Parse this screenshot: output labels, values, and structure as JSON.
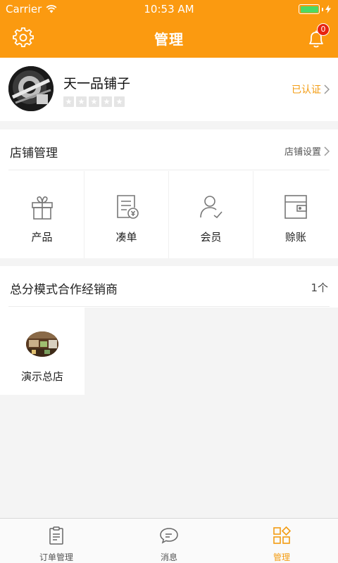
{
  "status_bar": {
    "carrier": "Carrier",
    "time": "10:53 AM"
  },
  "nav": {
    "title": "管理",
    "notification_count": "0"
  },
  "profile": {
    "shop_name": "天一品铺子",
    "verified_label": "已认证",
    "rating": 0,
    "rating_max": 5
  },
  "store_management": {
    "title": "店铺管理",
    "settings_link": "店铺设置",
    "items": [
      {
        "label": "产品",
        "icon": "gift-icon"
      },
      {
        "label": "凑单",
        "icon": "invoice-icon"
      },
      {
        "label": "会员",
        "icon": "member-icon"
      },
      {
        "label": "赊账",
        "icon": "wallet-icon"
      }
    ]
  },
  "dealers": {
    "title": "总分模式合作经销商",
    "count": "1个",
    "items": [
      {
        "name": "演示总店"
      }
    ]
  },
  "tabbar": {
    "items": [
      {
        "label": "订单管理",
        "icon": "clipboard-icon",
        "active": false
      },
      {
        "label": "消息",
        "icon": "chat-icon",
        "active": false
      },
      {
        "label": "管理",
        "icon": "grid-icon",
        "active": true
      }
    ]
  },
  "colors": {
    "brand_orange": "#fb9a10",
    "accent_text": "#f39c12",
    "badge_red": "#e8240f"
  }
}
